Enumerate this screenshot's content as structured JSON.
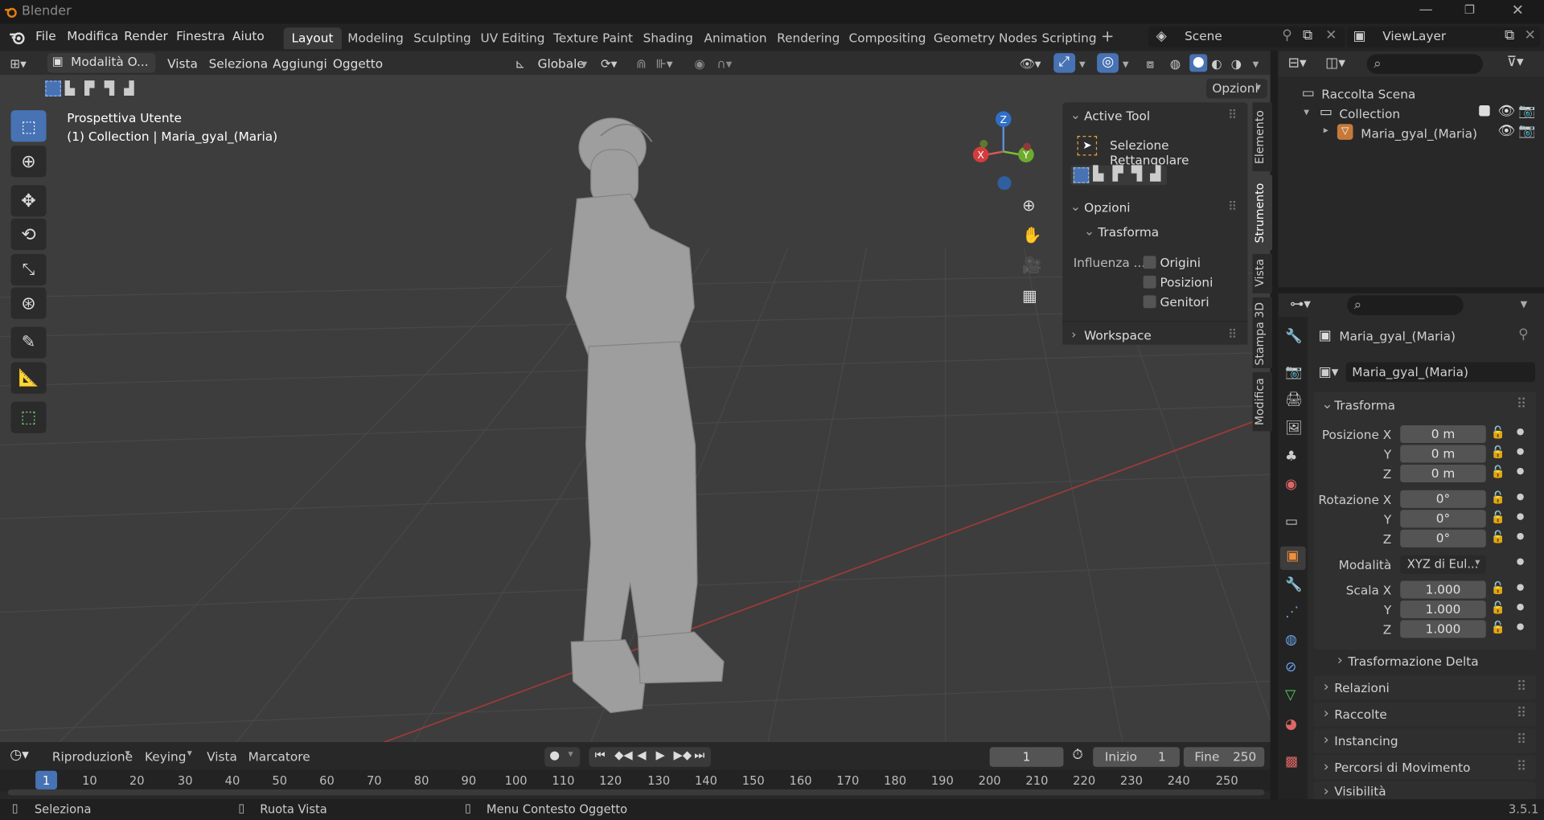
{
  "app": {
    "title": "Blender",
    "version": "3.5.1"
  },
  "menu": {
    "items": [
      "File",
      "Modifica",
      "Render",
      "Finestra",
      "Aiuto"
    ]
  },
  "workspaces": {
    "active": "Layout",
    "tabs": [
      "Layout",
      "Modeling",
      "Sculpting",
      "UV Editing",
      "Texture Paint",
      "Shading",
      "Animation",
      "Rendering",
      "Compositing",
      "Geometry Nodes",
      "Scripting"
    ]
  },
  "scene": {
    "scene_name": "Scene",
    "view_layer": "ViewLayer"
  },
  "viewport": {
    "mode": "Modalità O...",
    "menu": [
      "Vista",
      "Seleziona",
      "Aggiungi",
      "Oggetto"
    ],
    "orientation": "Globale",
    "options_label": "Opzioni",
    "perspective": "Prospettiva Utente",
    "collection_info": "(1) Collection | Maria_gyal_(Maria)",
    "gizmo": {
      "x": "X",
      "y": "Y",
      "z": "Z"
    }
  },
  "npanel": {
    "active_tool_header": "Active Tool",
    "tool_name": "Selezione Rettangolare",
    "options_header": "Opzioni",
    "transform_header": "Trasforma",
    "influence_label": "Influenza ...",
    "checks": [
      "Origini",
      "Posizioni",
      "Genitori"
    ],
    "workspace_header": "Workspace",
    "side_tabs": [
      "Elemento",
      "Strumento",
      "Vista",
      "Stampa 3D",
      "Modifica"
    ]
  },
  "outliner": {
    "root": "Raccolta Scena",
    "collection": "Collection",
    "object": "Maria_gyal_(Maria)"
  },
  "properties": {
    "object_name": "Maria_gyal_(Maria)",
    "data_name": "Maria_gyal_(Maria)",
    "transform_header": "Trasforma",
    "location": {
      "label": "Posizione X",
      "y": "Y",
      "z": "Z",
      "vx": "0 m",
      "vy": "0 m",
      "vz": "0 m"
    },
    "rotation": {
      "label": "Rotazione X",
      "y": "Y",
      "z": "Z",
      "vx": "0°",
      "vy": "0°",
      "vz": "0°"
    },
    "mode": {
      "label": "Modalità",
      "value": "XYZ di Eul..."
    },
    "scale": {
      "label": "Scala X",
      "y": "Y",
      "z": "Z",
      "vx": "1.000",
      "vy": "1.000",
      "vz": "1.000"
    },
    "delta": "Trasformazione Delta",
    "sections": [
      "Relazioni",
      "Raccolte",
      "Instancing",
      "Percorsi di Movimento",
      "Visibilità"
    ]
  },
  "timeline": {
    "menu": [
      "Riproduzione",
      "Keying",
      "Vista",
      "Marcatore"
    ],
    "current_frame": "1",
    "start_label": "Inizio",
    "start": "1",
    "end_label": "Fine",
    "end": "250",
    "ticks": [
      "1",
      "10",
      "20",
      "30",
      "40",
      "50",
      "60",
      "70",
      "80",
      "90",
      "100",
      "110",
      "120",
      "130",
      "140",
      "150",
      "160",
      "170",
      "180",
      "190",
      "200",
      "210",
      "220",
      "230",
      "240",
      "250"
    ]
  },
  "status": {
    "select": "Seleziona",
    "rotate": "Ruota Vista",
    "context": "Menu Contesto Oggetto"
  }
}
